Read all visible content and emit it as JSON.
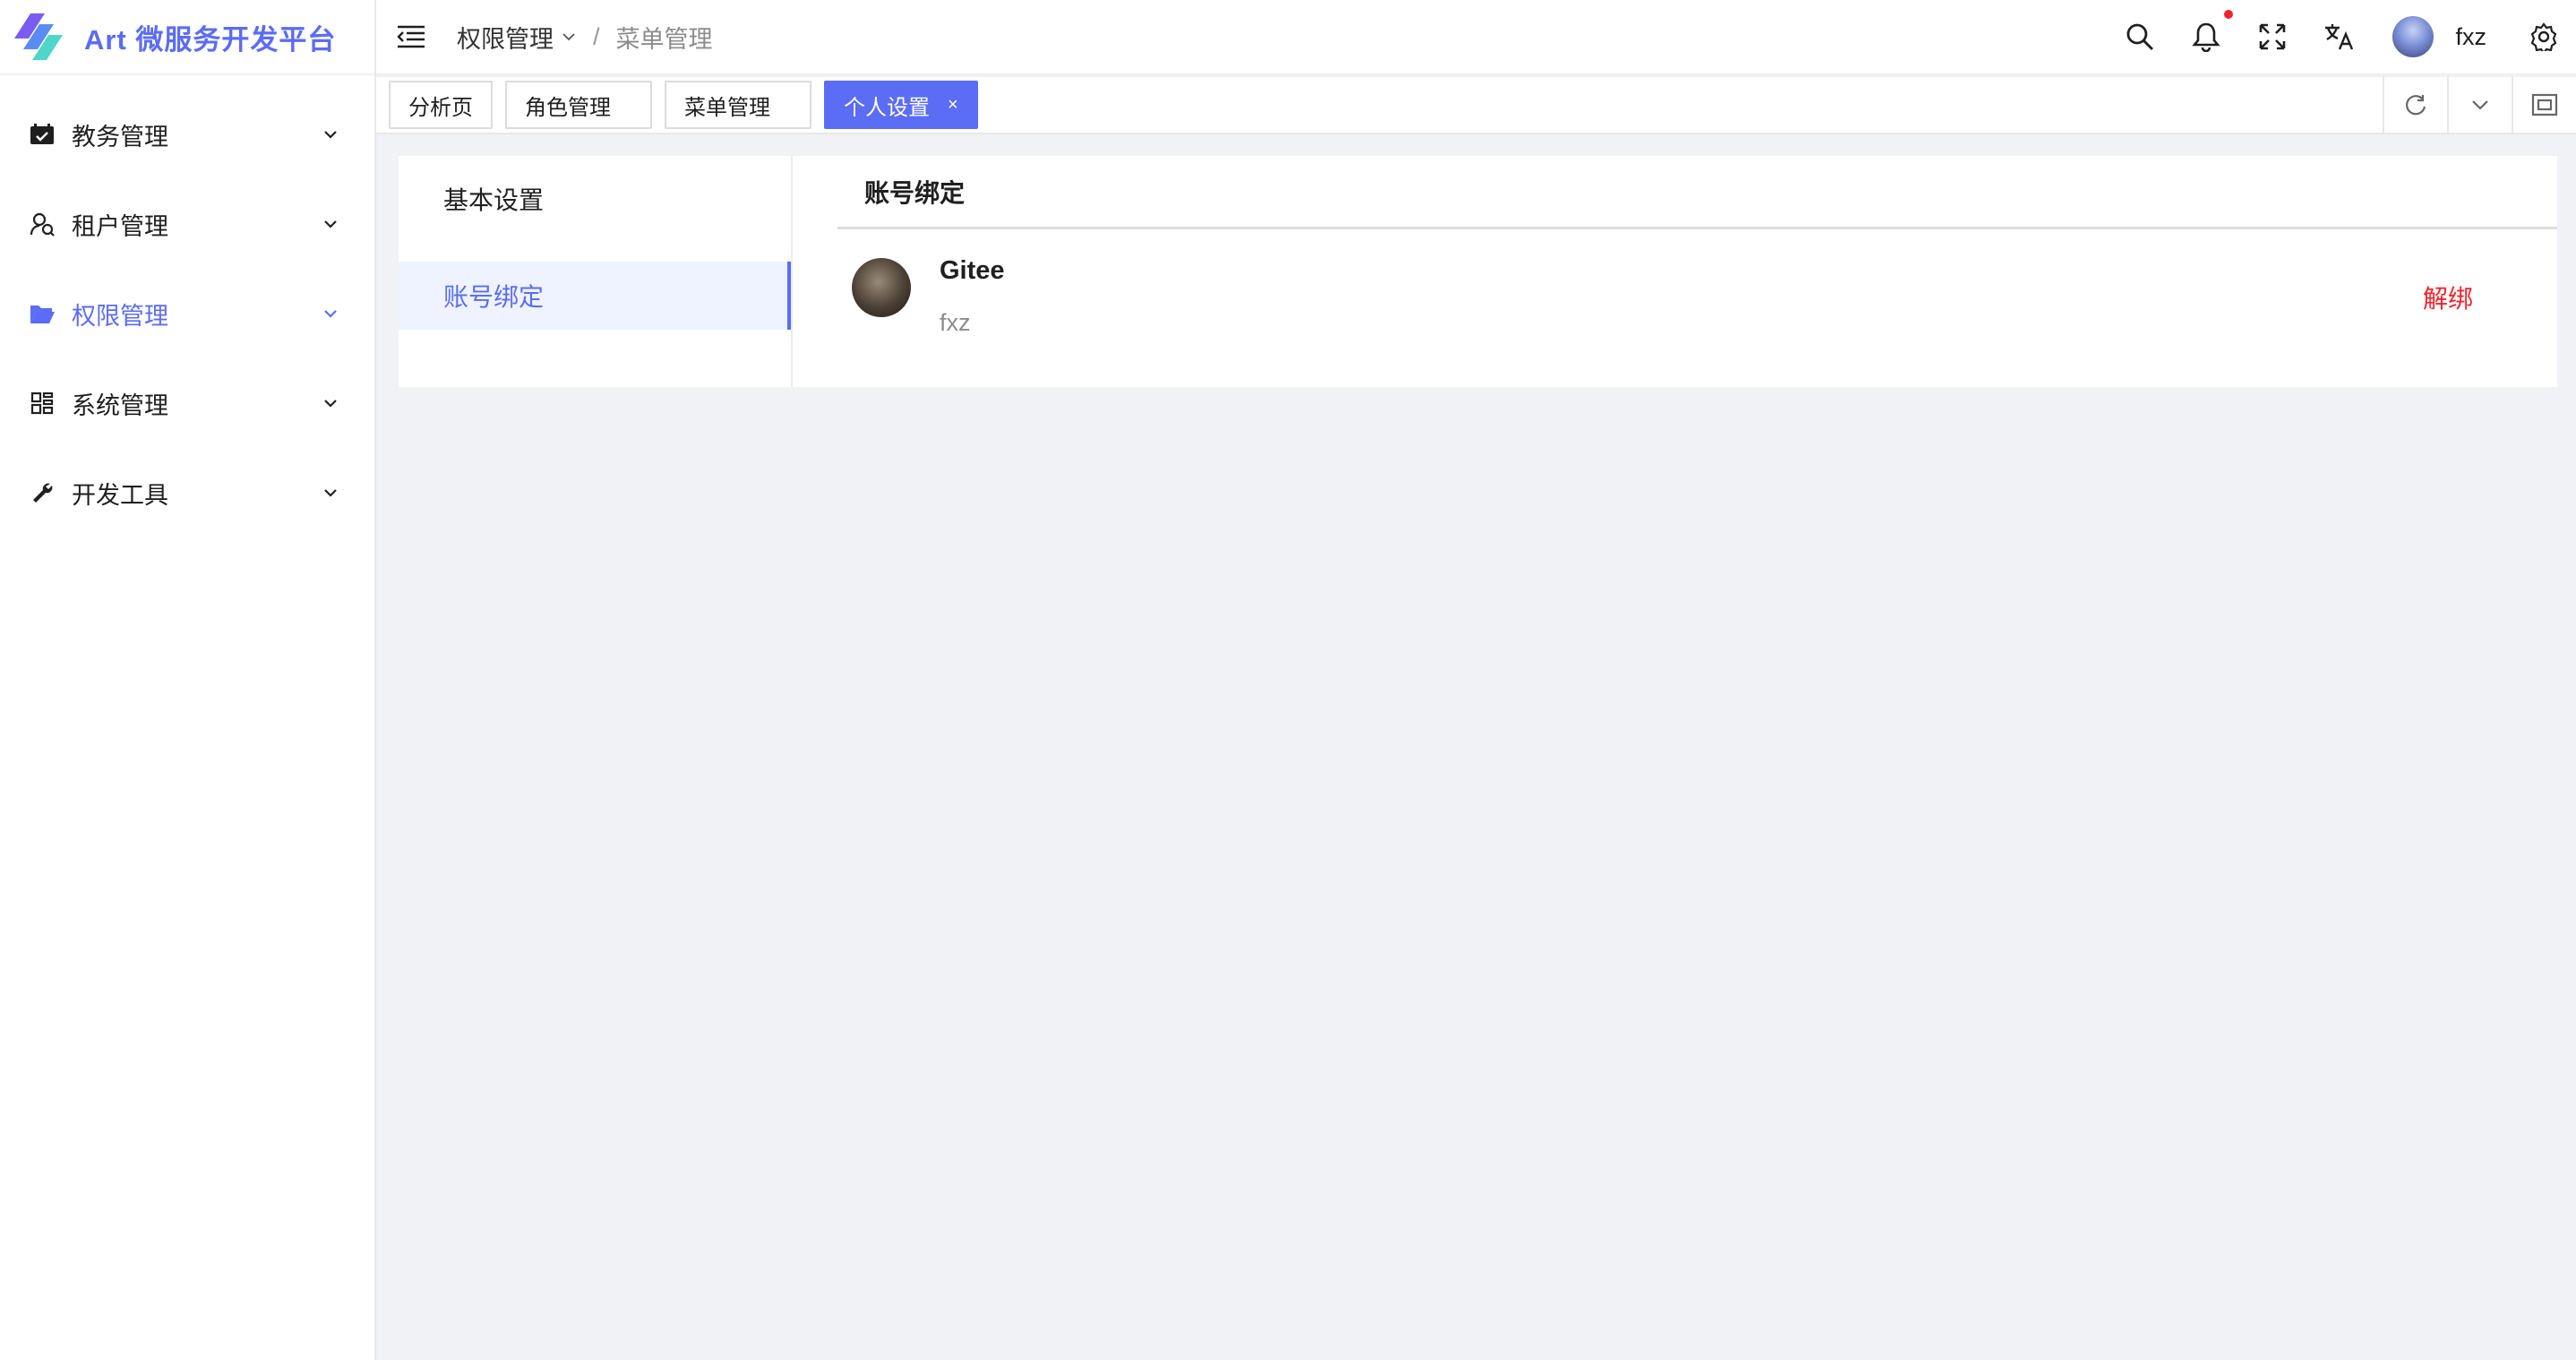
{
  "app": {
    "title": "Art 微服务开发平台"
  },
  "sidebar": {
    "items": [
      {
        "label": "教务管理",
        "icon": "calendar-check-icon"
      },
      {
        "label": "租户管理",
        "icon": "user-group-icon"
      },
      {
        "label": "权限管理",
        "icon": "folder-open-icon",
        "active": true
      },
      {
        "label": "系统管理",
        "icon": "apps-icon"
      },
      {
        "label": "开发工具",
        "icon": "wrench-icon"
      }
    ]
  },
  "header": {
    "breadcrumb": {
      "parent": "权限管理",
      "separator": "/",
      "current": "菜单管理"
    },
    "user_name": "fxz"
  },
  "tabs": [
    {
      "label": "分析页"
    },
    {
      "label": "角色管理"
    },
    {
      "label": "菜单管理"
    },
    {
      "label": "个人设置",
      "active": true,
      "close": "×"
    }
  ],
  "settings": {
    "nav": [
      {
        "label": "基本设置"
      },
      {
        "label": "账号绑定",
        "active": true
      }
    ],
    "pane_title": "账号绑定",
    "bindings": [
      {
        "platform": "Gitee",
        "username": "fxz",
        "action": "解绑"
      }
    ]
  },
  "colors": {
    "accent": "#5b6cf5",
    "danger": "#f5222d",
    "notify_dot": "#f5222d"
  }
}
